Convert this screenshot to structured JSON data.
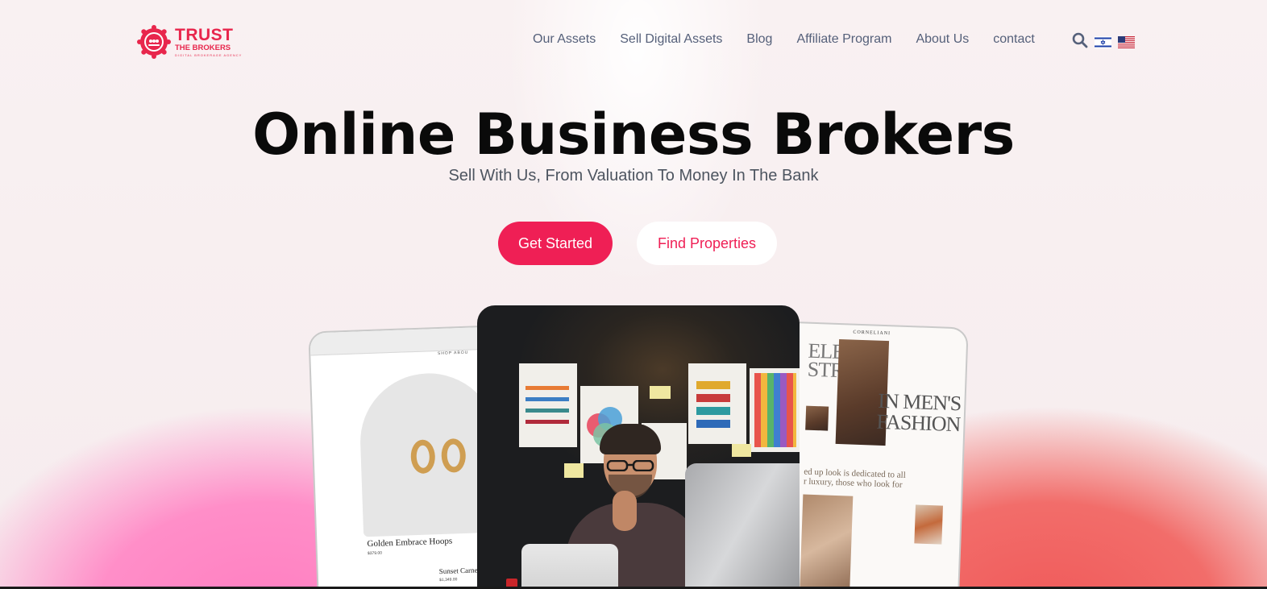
{
  "brand": {
    "name_line1": "TRUST",
    "name_line2": "THE BROKERS",
    "tagline": "DIGITAL BROKERAGE AGENCY",
    "accent_color": "#ef1f55"
  },
  "nav": {
    "items": [
      {
        "label": "Our Assets"
      },
      {
        "label": "Sell Digital Assets"
      },
      {
        "label": "Blog"
      },
      {
        "label": "Affiliate Program"
      },
      {
        "label": "About Us"
      },
      {
        "label": "contact"
      }
    ],
    "icons": [
      "search-icon",
      "israel-flag-icon",
      "us-flag-icon"
    ]
  },
  "hero": {
    "title": "Online Business Brokers",
    "subtitle": "Sell With Us, From Valuation To Money In The Bank",
    "primary_button": "Get Started",
    "secondary_button": "Find Properties"
  },
  "showcase": {
    "left_card": {
      "menu": "SHOP   ABOU",
      "product1_name": "Golden Embrace Hoops",
      "product1_price": "$379.00",
      "product2_name": "Sunset Carnel",
      "product2_price": "$1,349.00"
    },
    "right_card": {
      "brand": "CORNELIANI",
      "headline1": "ELESS\nSTRY",
      "headline2": "IN MEN'S\nFASHION",
      "body": "ed up look is dedicated to all r luxury, those who look for"
    }
  }
}
